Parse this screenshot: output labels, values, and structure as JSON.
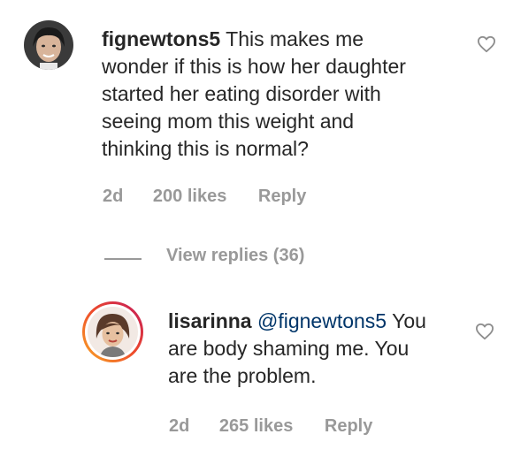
{
  "comment1": {
    "username": "fignewtons5",
    "text": "This makes me wonder if this is how her daughter started her eating disorder with seeing mom this weight and thinking this is normal?",
    "line1_rest": "This makes me",
    "line2": "wonder if this is how her daughter",
    "line3": "started her eating disorder with",
    "line4": "seeing mom this weight and",
    "line5": "thinking this is normal?",
    "time": "2d",
    "likes": "200 likes",
    "reply_label": "Reply"
  },
  "view_replies": {
    "label": "View replies (36)"
  },
  "reply1": {
    "username": "lisarinna",
    "mention": "@fignewtons5",
    "line1_rest": "You",
    "line2": "are body shaming me. You",
    "line3": "are the problem.",
    "time": "2d",
    "likes": "265 likes",
    "reply_label": "Reply"
  },
  "icons": {
    "like": "heart-outline-icon"
  },
  "colors": {
    "text": "#262626",
    "meta": "#999999",
    "mention": "#003569",
    "story_ring_start": "#f9a825",
    "story_ring_end": "#c2185b"
  }
}
